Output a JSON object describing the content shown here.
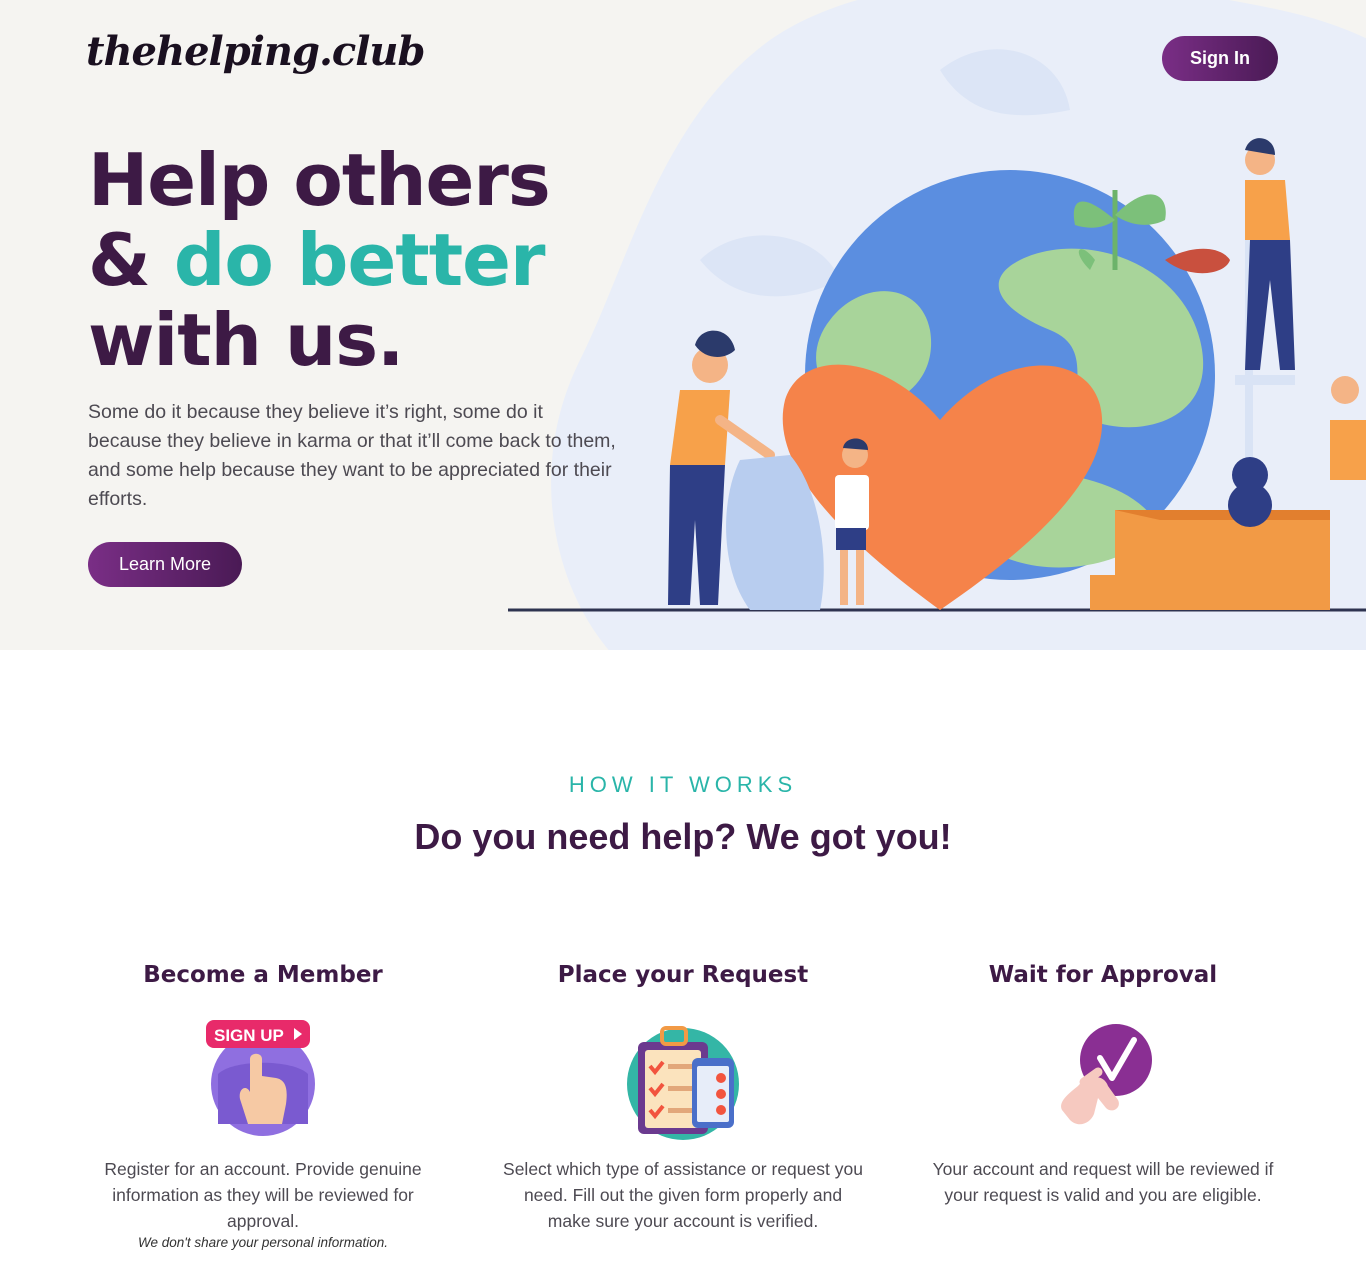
{
  "header": {
    "logo_text": "thehelping.club",
    "sign_in_label": "Sign In"
  },
  "hero": {
    "headline_line1": "Help others",
    "headline_line2_prefix": "& ",
    "headline_line2_accent": "do better",
    "headline_line3": "with us.",
    "description": "Some do it because they believe it’s right, some do it because they believe in karma or that it’ll come back to them, and some help because they want to be appreciated for their efforts.",
    "learn_more_label": "Learn More"
  },
  "how_it_works": {
    "eyebrow": "HOW IT WORKS",
    "title": "Do you need help? We got you!",
    "steps": [
      {
        "title": "Become a Member",
        "icon": "sign-up-icon",
        "icon_text": "SIGN UP",
        "description": "Register for an account. Provide genuine information as they will be reviewed for approval.",
        "note": "We don't share your personal information."
      },
      {
        "title": "Place your Request",
        "icon": "clipboard-checklist-icon",
        "description": "Select which type of assistance or request you need. Fill out the given form properly and make sure your account is verified."
      },
      {
        "title": "Wait for Approval",
        "icon": "checkmark-hand-icon",
        "description": "Your account and request will be reviewed if your request is valid and you are eligible."
      }
    ]
  },
  "colors": {
    "brand_purple": "#3d1a45",
    "button_gradient_start": "#7a2e86",
    "button_gradient_end": "#4a1a55",
    "accent_teal": "#2ab5a9",
    "hero_background": "#f5f4f1"
  }
}
